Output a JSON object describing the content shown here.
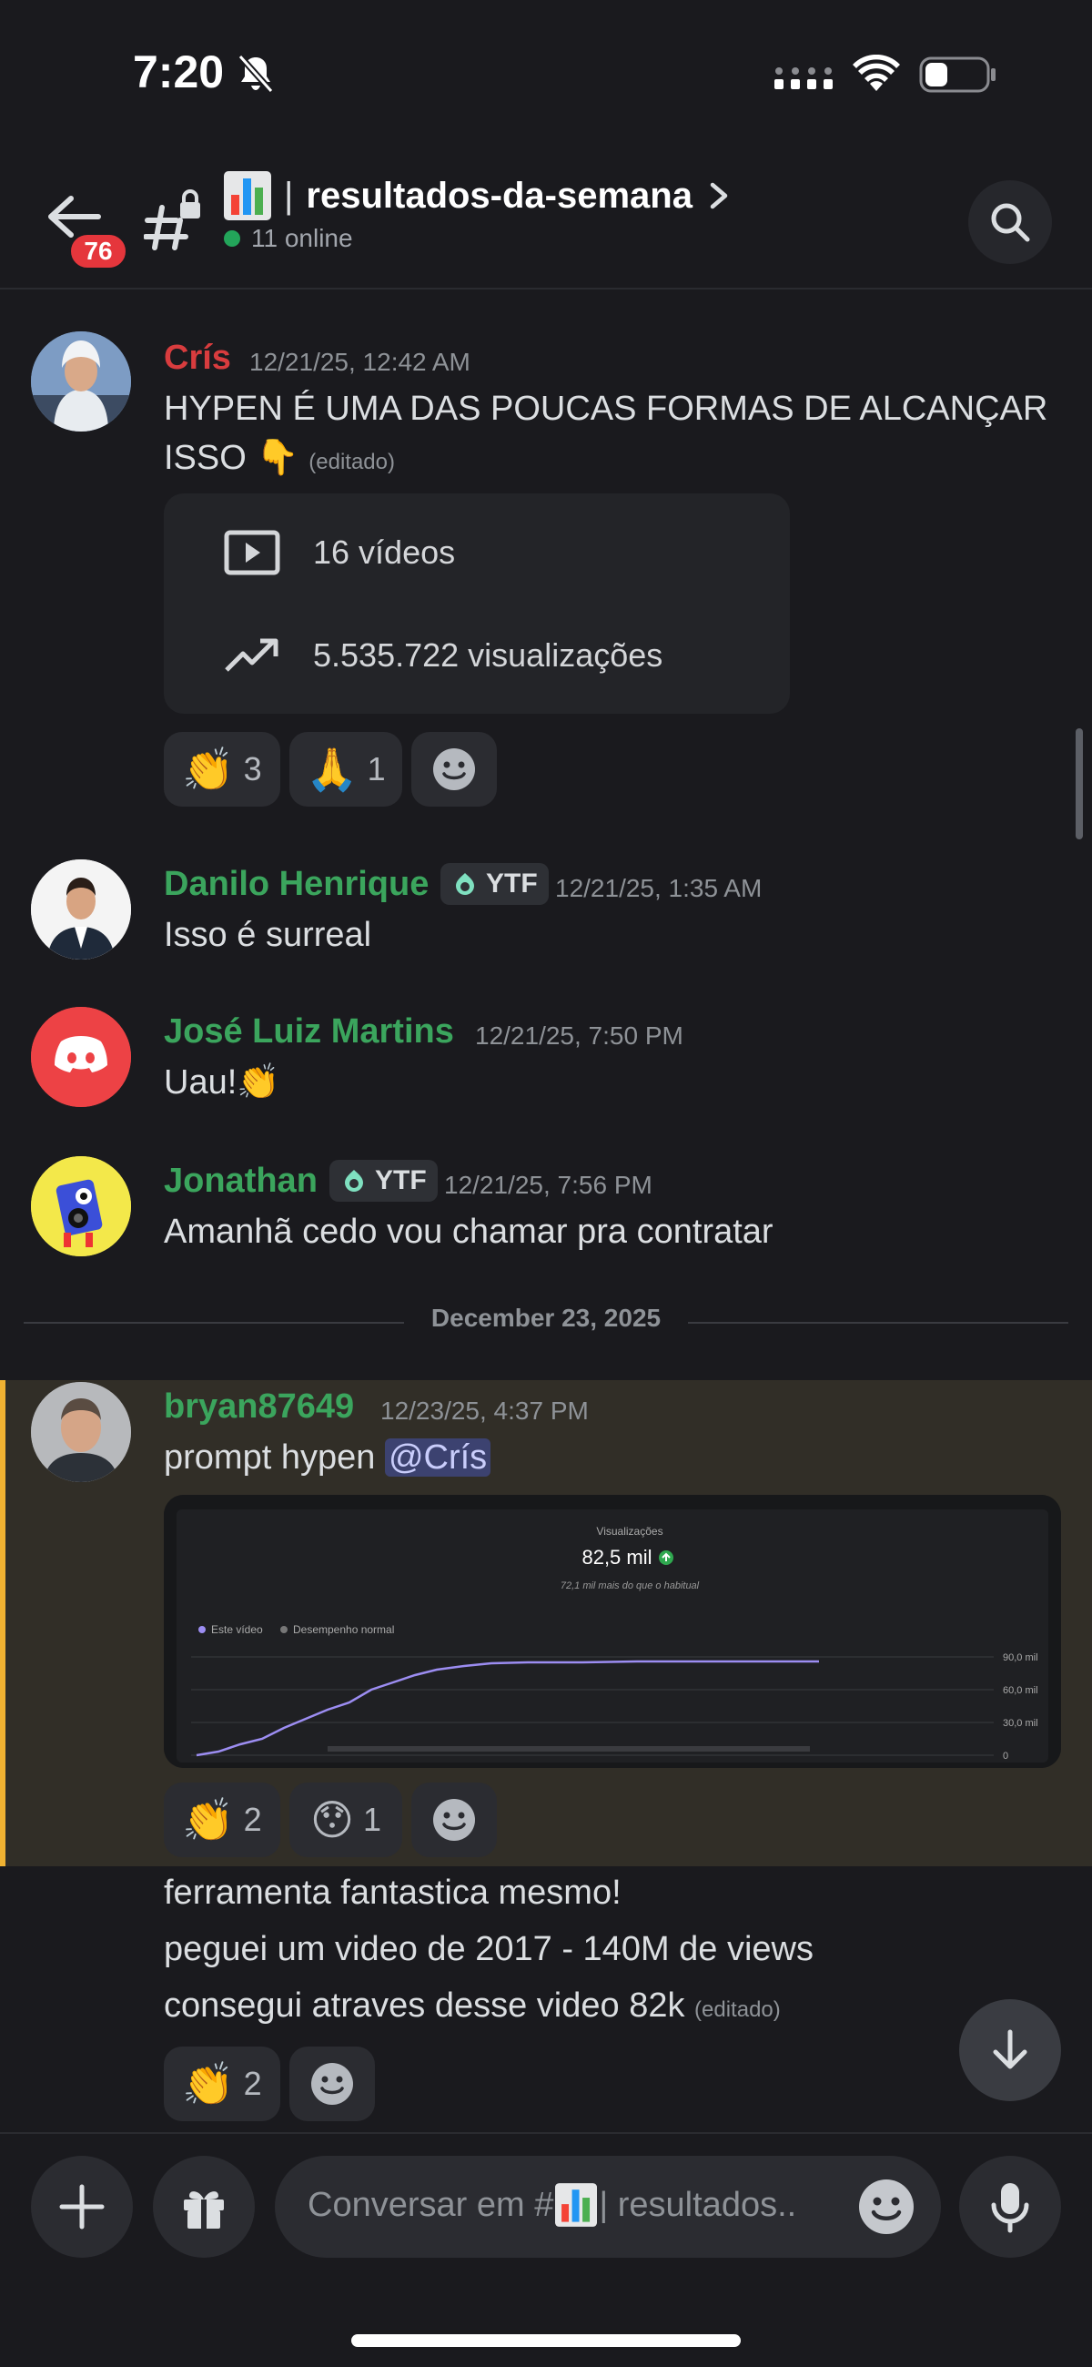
{
  "status_bar": {
    "time": "7:20",
    "icons": [
      "bell-slash-icon",
      "cellular-dots-icon",
      "wifi-icon",
      "battery-icon"
    ]
  },
  "header": {
    "back_badge": "76",
    "channel_emoji": "bar-chart-emoji",
    "separator": "|",
    "channel_name": "resultados-da-semana",
    "online": "11 online"
  },
  "messages": [
    {
      "author": "Crís",
      "author_color": "#d83c3e",
      "timestamp": "12/21/25, 12:42 AM",
      "line1": "HYPEN É UMA DAS POUCAS FORMAS DE ALCANÇAR",
      "line2": "ISSO 👇",
      "edited": "(editado)",
      "embed": {
        "videos": "16 vídeos",
        "views": "5.535.722 visualizações"
      },
      "reactions": [
        {
          "emoji": "👏",
          "count": "3"
        },
        {
          "emoji": "🙏",
          "count": "1"
        }
      ]
    },
    {
      "author": "Danilo Henrique",
      "author_color": "#3ba55d",
      "role": "YTF",
      "timestamp": "12/21/25, 1:35 AM",
      "text": "Isso é surreal"
    },
    {
      "author": "José Luiz Martins",
      "author_color": "#3ba55d",
      "timestamp": "12/21/25, 7:50 PM",
      "text": "Uau!👏"
    },
    {
      "author": "Jonathan",
      "author_color": "#3ba55d",
      "role": "YTF",
      "timestamp": "12/21/25, 7:56 PM",
      "text": "Amanhã cedo vou chamar pra contratar"
    }
  ],
  "date_divider": "December 23, 2025",
  "bryan": {
    "author": "bryan87649",
    "author_color": "#3ba55d",
    "timestamp": "12/23/25, 4:37 PM",
    "text": "prompt hypen",
    "mention": "@Crís",
    "image": {
      "title": "Visualizações",
      "value": "82,5 mil",
      "subtitle": "72,1 mil mais do que o habitual",
      "legend_a": "Este vídeo",
      "legend_b": "Desempenho normal",
      "y_ticks": [
        "90,0 mil",
        "60,0 mil",
        "30,0 mil",
        "0"
      ]
    },
    "reactions": [
      {
        "emoji": "👏",
        "count": "2"
      },
      {
        "emoji": "😯",
        "count": "1"
      }
    ],
    "follow_lines": [
      "ferramenta fantastica mesmo!",
      "peguei um video de 2017  - 140M de views",
      "consegui atraves desse video 82k"
    ],
    "edited": "(editado)",
    "follow_reactions": [
      {
        "emoji": "👏",
        "count": "2"
      }
    ]
  },
  "composer": {
    "placeholder_prefix": "Conversar em #",
    "placeholder_suffix": " | resultados.."
  }
}
